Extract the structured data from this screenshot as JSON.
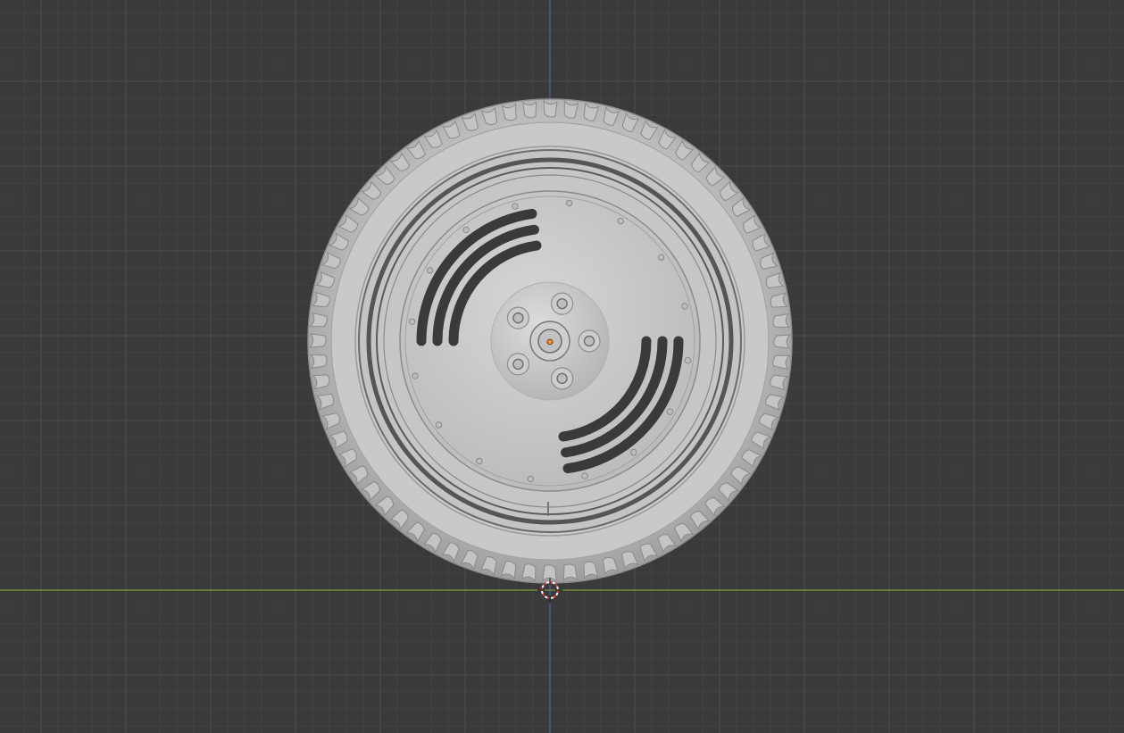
{
  "viewport": {
    "background_color": "#3a3a3a",
    "minor_grid_color": "#444444",
    "major_grid_color": "#4c4c4c",
    "x_axis_color": "#7a9a3a",
    "z_axis_color": "#4a6ab8",
    "view": "front-orthographic"
  },
  "object": {
    "type": "wheel",
    "tire_color": "#bdbdbd",
    "rim_color": "#c8c8c8",
    "slot_color": "#3a3a3a",
    "origin_color": "#ff8a1a",
    "lug_nut_count": 5,
    "slot_group_count": 2,
    "slots_per_group": 3
  },
  "cursor_3d": {
    "icon": "3d-cursor-icon",
    "colors": [
      "#d43a3a",
      "#ffffff"
    ]
  }
}
